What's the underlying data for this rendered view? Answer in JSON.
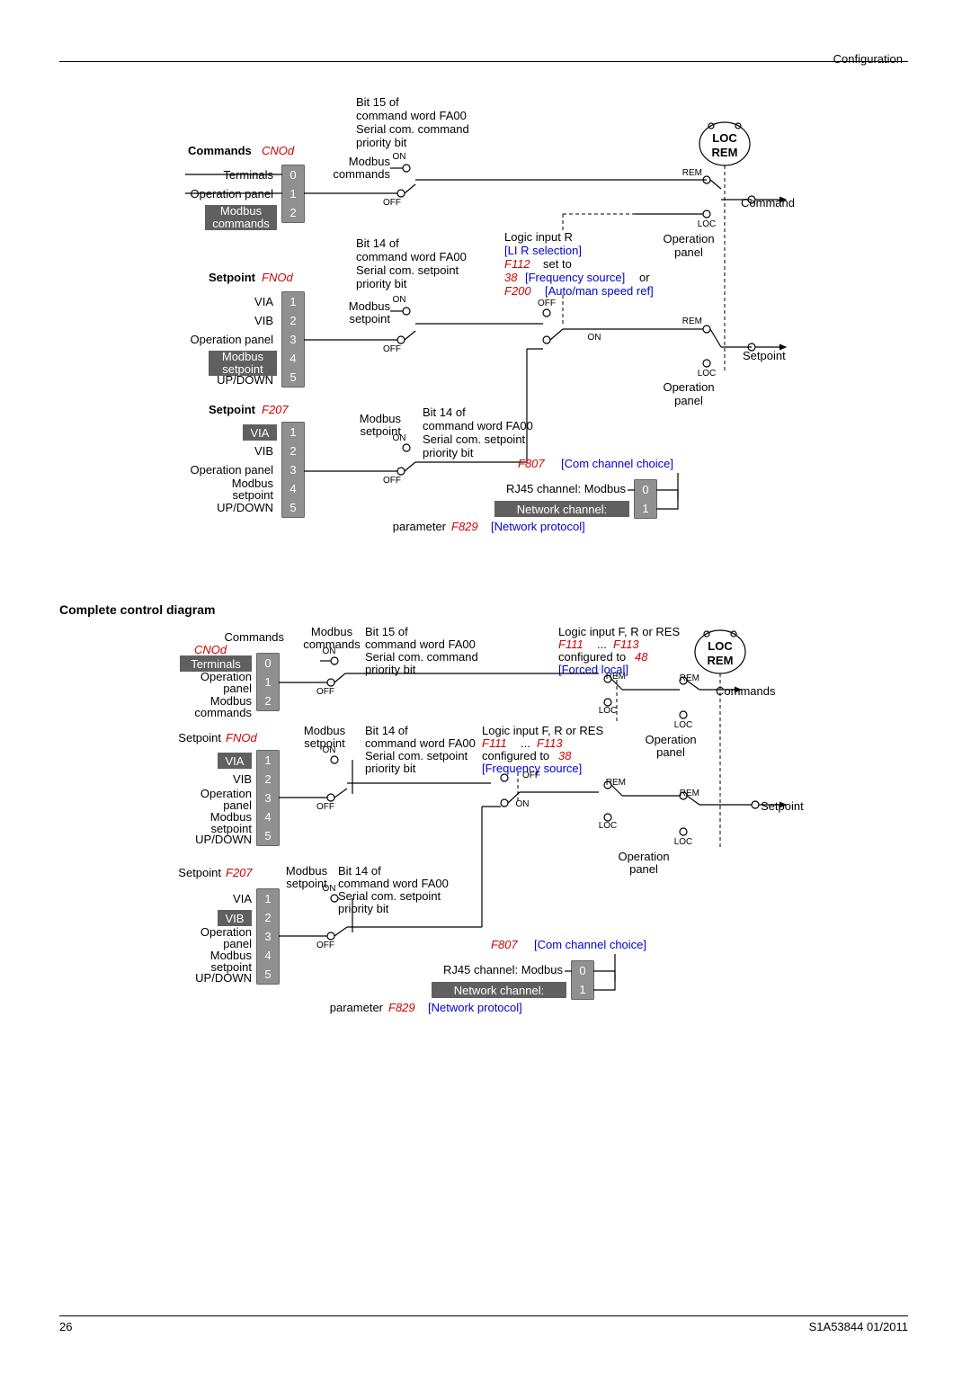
{
  "header": {
    "right": "Configuration"
  },
  "footer": {
    "page": "26",
    "doc": "S1A53844 01/2011"
  },
  "sec2_title": "Complete control diagram",
  "d1": {
    "bit15": {
      "l1": "Bit 15 of",
      "l2": "command word FA00",
      "l3": "Serial com. command",
      "l4": "priority bit"
    },
    "bit14set": {
      "l1": "Bit 14 of",
      "l2": "command word FA00",
      "l3": "Serial com. setpoint",
      "l4": "priority bit"
    },
    "bit14set2": {
      "l1": "Bit 14 of",
      "l2": "command word FA00",
      "l3": "Serial com. setpoint",
      "l4": "priority bit"
    },
    "cmd_lbl": "Commands",
    "cmd_code": "CNOd",
    "cmd_items": [
      "Terminals",
      "Operation panel",
      "Modbus\ncommands"
    ],
    "cmd_vals": [
      "0",
      "1",
      "2"
    ],
    "modbus_cmds": "Modbus\ncommands",
    "set_lbl": "Setpoint",
    "set_code": "FNOd",
    "set_items": [
      "VIA",
      "VIB",
      "Operation panel",
      "Modbus\nsetpoint",
      "UP/DOWN"
    ],
    "set_vals": [
      "1",
      "2",
      "3",
      "4",
      "5"
    ],
    "modbus_set": "Modbus\nsetpoint",
    "set2_lbl": "Setpoint",
    "set2_code": "F207",
    "set2_items": [
      "VIA",
      "VIB",
      "Operation panel",
      "Modbus\nsetpoint",
      "UP/DOWN"
    ],
    "set2_vals": [
      "1",
      "2",
      "3",
      "4",
      "5"
    ],
    "on": "ON",
    "off": "OFF",
    "rem": "REM",
    "loc": "LOC",
    "locrem_loc": "LOC",
    "locrem_rem": "REM",
    "command_out": "Command",
    "setpoint_out": "Setpoint",
    "op_panel": "Operation\npanel",
    "logicR": {
      "l1": "Logic input R",
      "l2": "[LI R selection]",
      "l3a": "F112",
      "l3b": "set to",
      "l4a": "38",
      "l4b": "[Frequency source]",
      "l4c": "or",
      "l5a": "F200",
      "l5b": "[Auto/man speed ref]"
    },
    "f807a": "F807",
    "f807b": "[Com channel choice]",
    "rj45": "RJ45 channel: Modbus",
    "rj45_val": "0",
    "netch": "Network channel:",
    "netch_val": "1",
    "param": "parameter",
    "f829": "F829",
    "netprot": "[Network protocol]"
  },
  "d2": {
    "bit15": {
      "l1": "Bit 15 of",
      "l2": "command word FA00",
      "l3": "Serial com. command",
      "l4": "priority bit"
    },
    "bit14set": {
      "l1": "Bit 14 of",
      "l2": "command word FA00",
      "l3": "Serial com. setpoint",
      "l4": "priority bit"
    },
    "bit14set2": {
      "l1": "Bit 14 of",
      "l2": "command word FA00",
      "l3": "Serial com. setpoint",
      "l4": "priority bit"
    },
    "cmd_lbl": "Commands",
    "cmd_code": "CNOd",
    "cmd_items": [
      "Terminals",
      "Operation\npanel",
      "Modbus\ncommands"
    ],
    "cmd_vals": [
      "0",
      "1",
      "2"
    ],
    "modbus_cmds": "Modbus\ncommands",
    "set_lbl": "Setpoint",
    "set_code": "FNOd",
    "set_items": [
      "VIA",
      "VIB",
      "Operation\npanel",
      "Modbus\nsetpoint",
      "UP/DOWN"
    ],
    "set_vals": [
      "1",
      "2",
      "3",
      "4",
      "5"
    ],
    "modbus_set": "Modbus\nsetpoint",
    "set2_lbl": "Setpoint",
    "set2_code": "F207",
    "set2_items": [
      "VIA",
      "VIB",
      "Operation\npanel",
      "Modbus\nsetpoint",
      "UP/DOWN"
    ],
    "set2_vals": [
      "1",
      "2",
      "3",
      "4",
      "5"
    ],
    "on": "ON",
    "off": "OFF",
    "rem": "REM",
    "loc": "LOC",
    "locrem_loc": "LOC",
    "locrem_rem": "REM",
    "cmds_out": "Commands",
    "setpoint_out": "Setpoint",
    "op_panel": "Operation\npanel",
    "logic_top": {
      "l1": "Logic input F, R or RES",
      "l2a": "F111",
      "l2b": "...",
      "l2c": "F113",
      "l3a": "configured to",
      "l3b": "48",
      "l4": "[Forced local]"
    },
    "logic_mid": {
      "l1": "Logic input F, R or RES",
      "l2a": "F111",
      "l2b": "...",
      "l2c": "F113",
      "l3a": "configured to",
      "l3b": "38",
      "l4": "[Frequency source]"
    },
    "f807a": "F807",
    "f807b": "[Com channel choice]",
    "rj45": "RJ45 channel: Modbus",
    "rj45_val": "0",
    "netch": "Network channel:",
    "netch_val": "1",
    "param": "parameter",
    "f829": "F829",
    "netprot": "[Network protocol]"
  }
}
